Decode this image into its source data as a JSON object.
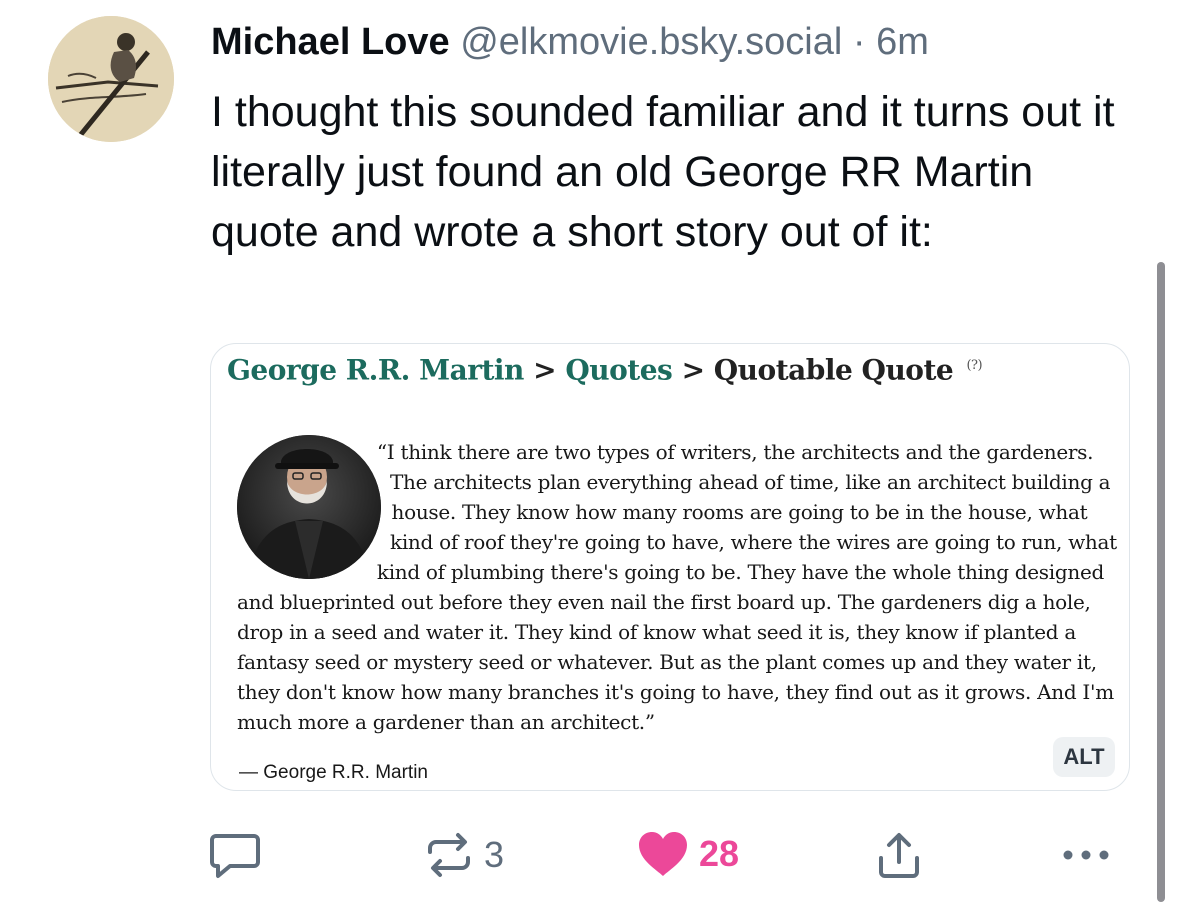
{
  "post": {
    "author_name": "Michael Love",
    "handle": "@elkmovie.bsky.social",
    "separator": "·",
    "time": "6m",
    "text": "I thought this sounded familiar and it turns out it literally just found an old George RR Martin quote and wrote a short story out of it:"
  },
  "embed": {
    "breadcrumbs": [
      "George R.R. Martin",
      "Quotes",
      "Quotable Quote"
    ],
    "crumb_separator": ">",
    "help_mark": "(?)",
    "quote": "“I think there are two types of writers, the architects and the gardeners. The architects plan everything ahead of time, like an architect building a house. They know how many rooms are going to be in the house, what kind of roof they're going to have, where the wires are going to run, what kind of plumbing there's going to be. They have the whole thing designed and blueprinted out before they even nail the first board up. The gardeners dig a hole, drop in a seed and water it. They kind of know what seed it is, they know if planted a fantasy seed or mystery seed or whatever. But as the plant comes up and they water it, they don't know how many branches it's going to have, they find out as it grows. And I'm much more a gardener than an architect.”",
    "attribution": "― George R.R. Martin",
    "alt_label": "ALT"
  },
  "actions": {
    "reply_icon": "reply-icon",
    "repost_icon": "repost-icon",
    "repost_count": "3",
    "like_icon": "heart-icon",
    "like_count": "28",
    "share_icon": "share-icon",
    "more_icon": "more-icon"
  },
  "colors": {
    "text": "#0b0f14",
    "muted": "#5f6d7c",
    "link_green": "#1c6b5e",
    "like_pink": "#ec4899",
    "alt_badge_bg": "#eef1f3"
  }
}
